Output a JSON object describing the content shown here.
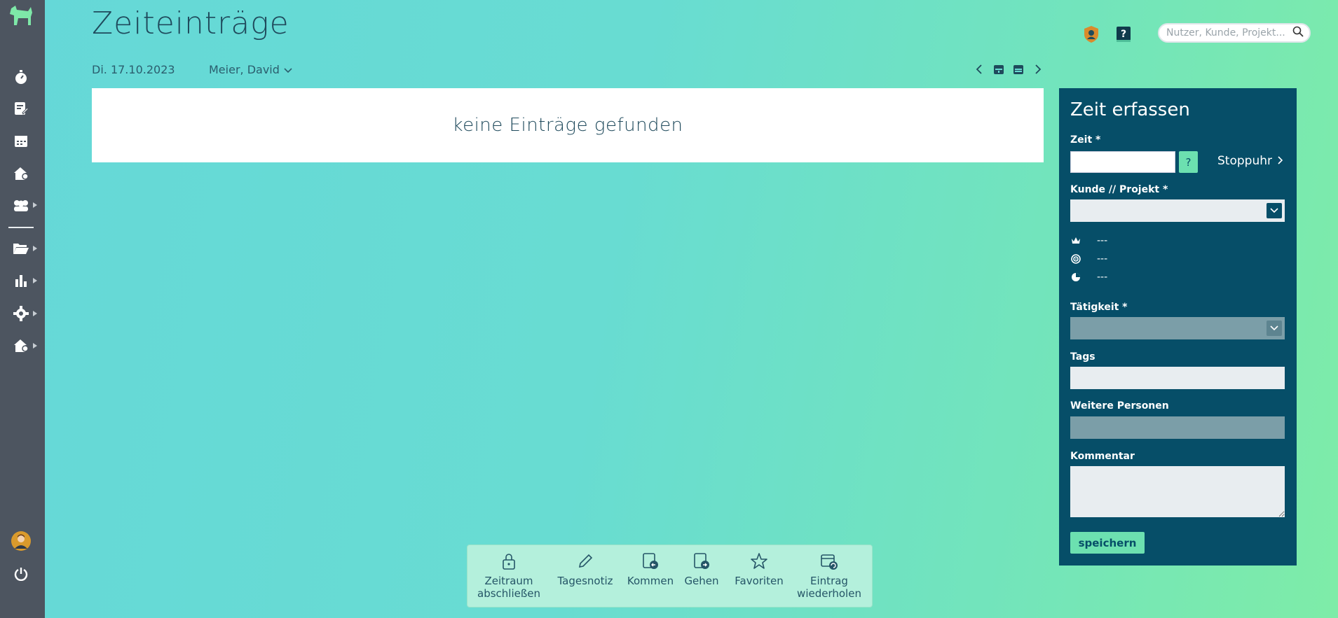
{
  "page": {
    "title": "Zeiteinträge"
  },
  "header": {
    "date": "Di. 17.10.2023",
    "user": "Meier, David",
    "search_placeholder": "Nutzer, Kunde, Projekt..."
  },
  "entries": {
    "empty_text": "keine Einträge gefunden"
  },
  "form": {
    "title": "Zeit erfassen",
    "time_label": "Zeit *",
    "time_help": "?",
    "stopwatch_label": "Stoppuhr",
    "customer_project_label": "Kunde // Projekt *",
    "meta": [
      "---",
      "---",
      "---"
    ],
    "activity_label": "Tätigkeit *",
    "tags_label": "Tags",
    "more_persons_label": "Weitere Personen",
    "comment_label": "Kommentar",
    "save_label": "speichern"
  },
  "toolbar": {
    "items": [
      {
        "label": "Zeitraum abschließen",
        "icon": "lock-icon"
      },
      {
        "label": "Tagesnotiz",
        "icon": "pencil-icon"
      },
      {
        "label": "Kommen",
        "icon": "clock-in-icon"
      },
      {
        "label": "Gehen",
        "icon": "clock-out-icon"
      },
      {
        "label": "Favoriten",
        "icon": "star-icon"
      },
      {
        "label": "Eintrag wiederholen",
        "icon": "repeat-icon"
      }
    ]
  },
  "colors": {
    "sidebar": "#4d5560",
    "panel": "#064e68",
    "accent": "#6ce0b0"
  }
}
